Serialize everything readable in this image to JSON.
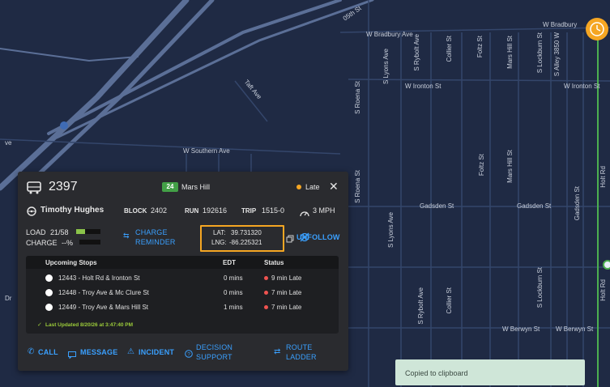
{
  "map": {
    "streets": {
      "w_bradbury_ave": "W Bradbury Ave",
      "w_bradbury_2": "W Bradbury",
      "w_ironton_st": "W Ironton St",
      "w_ironton_st_2": "W Ironton St",
      "w_southern_ave": "W Southern Ave",
      "taft_ave": "Taft Ave",
      "s_lyons_ave": "S Lyons Ave",
      "s_lyons_ave_2": "S Lyons Ave",
      "s_rybolt_ave": "S Rybolt Ave",
      "s_rybolt_ave_2": "S Rybolt Ave",
      "collier_st": "Collier St",
      "collier_st_2": "Collier St",
      "foltz_st": "Foltz St",
      "foltz_st_2": "Foltz St",
      "mars_hill_st": "Mars Hill St",
      "mars_hill_st_2": "Mars Hill St",
      "s_lockburn_st": "S Lockburn St",
      "s_lockburn_st_2": "S Lockburn St",
      "s_alley_3850w": "S Alley 3850 W",
      "s_roena_st": "S Roena St",
      "s_roena_st_2": "S Roena St",
      "gadsden_st": "Gadsden St",
      "gadsden_st_2": "Gadsden St",
      "gadsden_st_3": "Gadsden St",
      "w_berwyn_st": "W Berwyn St",
      "w_berwyn_st_2": "W Berwyn St",
      "holt_rd": "Holt Rd",
      "holt_rd_2": "Holt Rd",
      "oth_st": "05th St",
      "dr": "Dr",
      "ve": "ve"
    }
  },
  "vehicle": {
    "number": "2397",
    "route_badge": "24",
    "route_name": "Mars Hill",
    "status": "Late",
    "status_color": "#f5a623",
    "operator": "Timothy Hughes",
    "block_label": "BLOCK",
    "block": "2402",
    "run_label": "RUN",
    "run": "192616",
    "trip_label": "TRIP",
    "trip": "1515-0",
    "speed": "3 MPH",
    "load_label": "LOAD",
    "load": "21/58",
    "load_fraction": 0.36,
    "charge_label": "CHARGE",
    "charge": "--%",
    "charge_reminder": "CHARGE REMINDER",
    "lat_label": "LAT:",
    "lat": "39.731320",
    "lng_label": "LNG:",
    "lng": "-86.225321",
    "unfollow": "UNFOLLOW"
  },
  "stops": {
    "headers": {
      "stops": "Upcoming Stops",
      "edt": "EDT",
      "status": "Status"
    },
    "rows": [
      {
        "name": "12443 - Holt Rd & Ironton St",
        "edt": "0 mins",
        "status": "9 min Late"
      },
      {
        "name": "12448 - Troy Ave & Mc Clure St",
        "edt": "0 mins",
        "status": "7 min Late"
      },
      {
        "name": "12449 - Troy Ave & Mars Hill St",
        "edt": "1 mins",
        "status": "7 min Late"
      }
    ],
    "last_updated": "Last Updated 8/20/26 at 3:47:40 PM"
  },
  "actions": {
    "call": "CALL",
    "message": "MESSAGE",
    "incident": "INCIDENT",
    "decision_support": "DECISION SUPPORT",
    "route_ladder": "ROUTE LADDER"
  },
  "toast": {
    "message": "Copied to clipboard"
  },
  "colors": {
    "accent": "#3aa0ff",
    "route_green": "#4caf50",
    "late_red": "#ef5350",
    "highlight": "#f5a623"
  }
}
